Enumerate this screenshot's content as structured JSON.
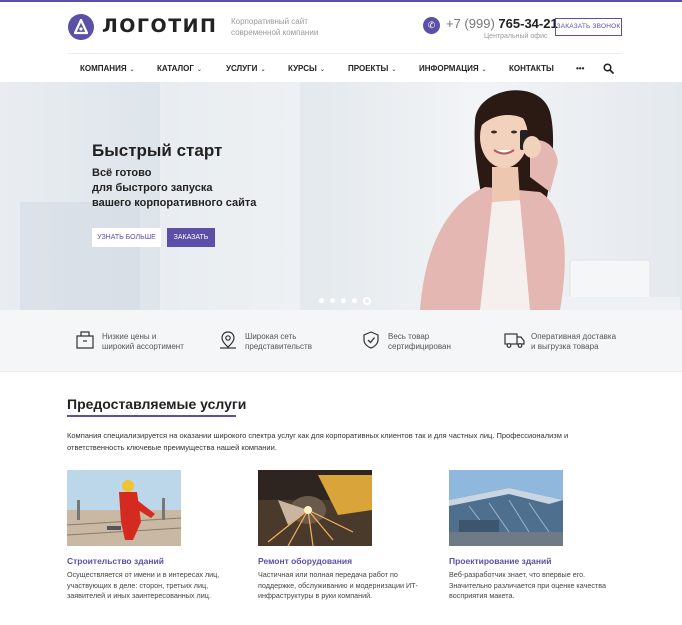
{
  "header": {
    "logo_text": "ЛОГОТИП",
    "tagline_1": "Корпоративный сайт",
    "tagline_2": "современной компании",
    "phone_prefix": "+7 (999)",
    "phone_number": "765-34-21",
    "office": "Центральный офис",
    "callback_label": "ЗАКАЗАТЬ ЗВОНОК"
  },
  "nav": {
    "items": [
      {
        "label": "КОМПАНИЯ"
      },
      {
        "label": "КАТАЛОГ"
      },
      {
        "label": "УСЛУГИ"
      },
      {
        "label": "КУРСЫ"
      },
      {
        "label": "ПРОЕКТЫ"
      },
      {
        "label": "ИНФОРМАЦИЯ"
      },
      {
        "label": "КОНТАКТЫ"
      },
      {
        "label": "•••"
      }
    ]
  },
  "hero": {
    "title": "Быстрый старт",
    "line_1": "Всё готово",
    "line_2": "для быстрого запуска",
    "line_3": "вашего корпоративного сайта",
    "btn_more": "УЗНАТЬ БОЛЬШЕ",
    "btn_order": "ЗАКАЗАТЬ",
    "slides_total": 5,
    "slide_active": 5
  },
  "features": [
    {
      "icon": "box-icon",
      "line_1": "Низкие цены и",
      "line_2": "широкий ассортимент"
    },
    {
      "icon": "map-pin-icon",
      "line_1": "Широкая сеть",
      "line_2": "представительств"
    },
    {
      "icon": "shield-check-icon",
      "line_1": "Весь товар",
      "line_2": "сертифицирован"
    },
    {
      "icon": "truck-icon",
      "line_1": "Оперативная доставка",
      "line_2": "и выгрузка товара"
    }
  ],
  "services": {
    "title": "Предоставляемые услуги",
    "description": "Компания специализируется на оказании широкого спектра услуг как для корпоративных клиентов так и для частных лиц. Профессионализм и ответственность ключевые преимущества нашей компании.",
    "cards": [
      {
        "title": "Строительство зданий",
        "text": "Осуществляется от имени и в интересах лиц, участвующих в деле: сторон, третьих лиц, заявителей и иных заинтересованных лиц."
      },
      {
        "title": "Ремонт оборудования",
        "text": "Частичная или полная передача работ по поддержке, обслуживанию и модернизации ИТ-инфраструктуры в руки компаний."
      },
      {
        "title": "Проектирование зданий",
        "text": "Веб-разработчик знает, что впервые его. Значительно различается при оценке качества восприятия макета."
      }
    ]
  },
  "colors": {
    "accent": "#5b4fa8"
  }
}
